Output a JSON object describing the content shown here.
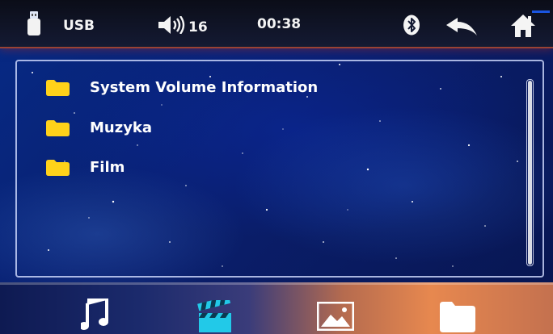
{
  "topbar": {
    "source_label": "USB",
    "volume_value": "16",
    "clock": "00:38",
    "icons": [
      "usb-drive-icon",
      "speaker-icon",
      "bluetooth-icon",
      "back-arrow-icon",
      "home-icon"
    ]
  },
  "files": [
    {
      "name": "System Volume Information",
      "icon": "folder-icon"
    },
    {
      "name": "Muzyka",
      "icon": "folder-icon"
    },
    {
      "name": "Film",
      "icon": "folder-icon"
    }
  ],
  "bottom_tabs": [
    {
      "icon": "music-note-icon",
      "active": false
    },
    {
      "icon": "clapperboard-icon",
      "active": true
    },
    {
      "icon": "picture-icon",
      "active": false
    },
    {
      "icon": "folder-icon",
      "active": false
    }
  ],
  "colors": {
    "folder": "#ffd21a",
    "active_tab": "#22c9e8",
    "inactive_tab": "#ffffff",
    "background": "#0a1f6e"
  }
}
